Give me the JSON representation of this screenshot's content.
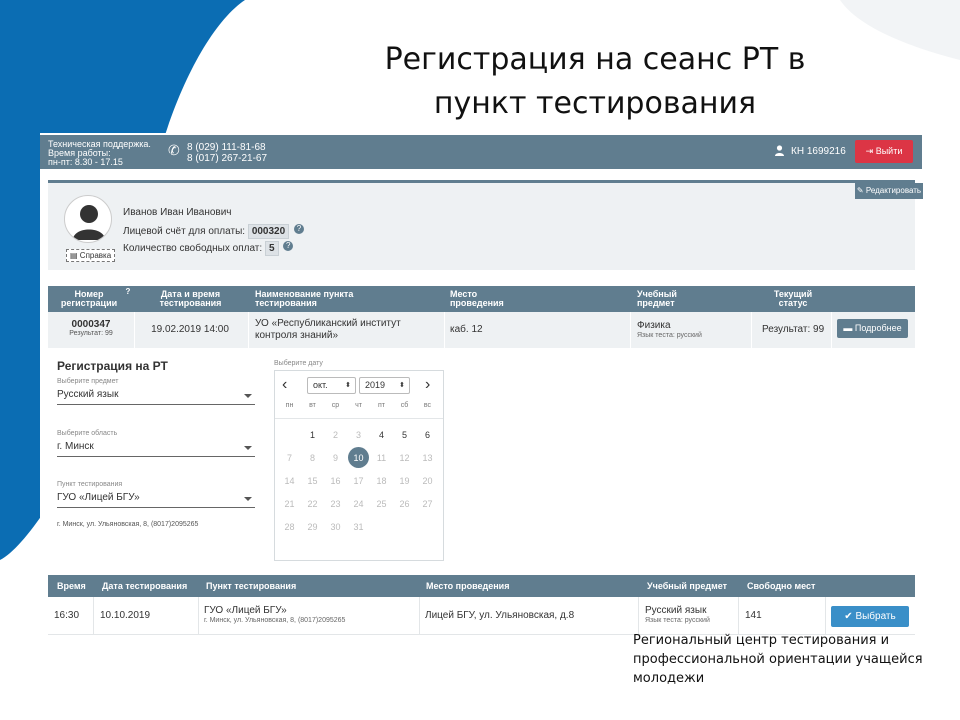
{
  "slide": {
    "title_line1": "Регистрация на сеанс РТ в",
    "title_line2": "пункт тестирования",
    "footer": "Региональный центр тестирования и профессиональной ориентации учащейся молодежи"
  },
  "topbar": {
    "support_line1": "Техническая поддержка.",
    "support_line2": "Время работы:",
    "support_line3": "пн-пт: 8.30 - 17.15",
    "phone1": "8 (029) 111-81-68",
    "phone2": "8 (017) 267-21-67",
    "user_id": "КН 1699216",
    "logout_label": "Выйти",
    "logout_icon": "logout-icon"
  },
  "profile": {
    "edit_label": "Редактировать",
    "name": "Иванов Иван Иванович",
    "account_label": "Лицевой счёт для оплаты:",
    "account_value": "000320",
    "free_label": "Количество свободных оплат:",
    "free_value": "5",
    "help_label": "Справка"
  },
  "sessions_table": {
    "headers": [
      "Номер регистрации",
      "Дата и время тестирования",
      "Наименование пункта тестирования",
      "Место проведения",
      "Учебный предмет",
      "Текущий статус"
    ],
    "rows": [
      {
        "number": "0000347",
        "result_small": "Результат: 99",
        "datetime": "19.02.2019 14:00",
        "point_line1": "УО «Республиканский институт",
        "point_line2": "контроля знаний»",
        "place": "каб. 12",
        "subject": "Физика",
        "subject_lang": "Язык теста: русский",
        "status": "Результат: 99",
        "button_label": "Подробнее"
      }
    ]
  },
  "registration": {
    "title": "Регистрация на РТ",
    "subject_label": "Выберите предмет",
    "subject_value": "Русский язык",
    "region_label": "Выберите область",
    "region_value": "г. Минск",
    "point_label": "Пункт тестирования",
    "point_value": "ГУО «Лицей БГУ»",
    "point_address": "г. Минск, ул. Ульяновская, 8, (8017)2095265"
  },
  "calendar": {
    "label": "Выберите дату",
    "month": "окт.",
    "year": "2019",
    "weekdays": [
      "пн",
      "вт",
      "ср",
      "чт",
      "пт",
      "сб",
      "вс"
    ],
    "weeks": [
      [
        "",
        "1",
        "2",
        "3",
        "4",
        "5",
        "6"
      ],
      [
        "7",
        "8",
        "9",
        "10",
        "11",
        "12",
        "13"
      ],
      [
        "14",
        "15",
        "16",
        "17",
        "18",
        "19",
        "20"
      ],
      [
        "21",
        "22",
        "23",
        "24",
        "25",
        "26",
        "27"
      ],
      [
        "28",
        "29",
        "30",
        "31",
        "",
        "",
        ""
      ]
    ],
    "active_days": [
      "1",
      "4",
      "5",
      "6"
    ],
    "selected_day": "10",
    "accent_color": "#607d8f"
  },
  "slots_table": {
    "headers": [
      "Время",
      "Дата тестирования",
      "Пункт тестирования",
      "Место проведения",
      "Учебный предмет",
      "Свободно мест"
    ],
    "rows": [
      {
        "time": "16:30",
        "date": "10.10.2019",
        "point": "ГУО «Лицей БГУ»",
        "point_address": "г. Минск, ул. Ульяновская, 8, (8017)2095265",
        "place": "Лицей БГУ, ул. Ульяновская, д.8",
        "subject": "Русский язык",
        "subject_lang": "Язык теста: русский",
        "free": "141",
        "button_label": "Выбрать"
      }
    ]
  },
  "colors": {
    "header_bg": "#607d8f",
    "danger": "#dc3545",
    "primary": "#3a8fc8",
    "slide_blue": "#0b6db3"
  }
}
